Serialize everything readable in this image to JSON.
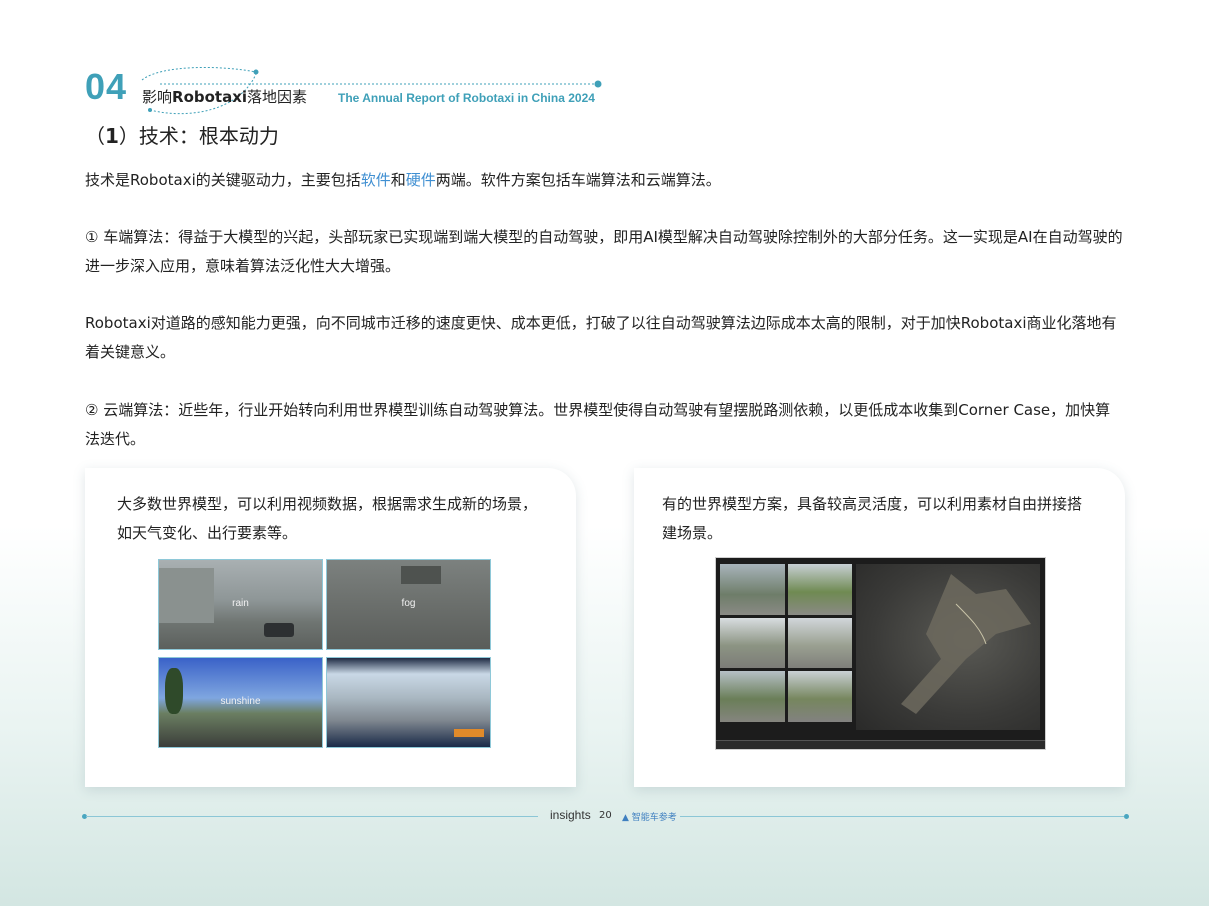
{
  "header": {
    "number": "04",
    "title_prefix": "影响",
    "title_bold": "Robotaxi",
    "title_suffix": "落地因素",
    "title_en": "The Annual Report of Robotaxi in China 2024"
  },
  "section": {
    "title_open": "（",
    "title_num": "1",
    "title_rest": "）技术：根本动力"
  },
  "intro": {
    "pre": "技术是Robotaxi的关键驱动力，主要包括",
    "software": "软件",
    "and": "和",
    "hardware": "硬件",
    "post": "两端。软件方案包括车端算法和云端算法。"
  },
  "para_vehicle": "① 车端算法：得益于大模型的兴起，头部玩家已实现端到端大模型的自动驾驶，即用AI模型解决自动驾驶除控制外的大部分任务。这一实现是AI在自动驾驶的进一步深入应用，意味着算法泛化性大大增强。",
  "para_perception": "Robotaxi对道路的感知能力更强，向不同城市迁移的速度更快、成本更低，打破了以往自动驾驶算法边际成本太高的限制，对于加快Robotaxi商业化落地有着关键意义。",
  "para_cloud": "② 云端算法：近些年，行业开始转向利用世界模型训练自动驾驶算法。世界模型使得自动驾驶有望摆脱路测依赖，以更低成本收集到Corner Case，加快算法迭代。",
  "card_left": {
    "text": "大多数世界模型，可以利用视频数据，根据需求生成新的场景，如天气变化、出行要素等。",
    "labels": {
      "rain": "rain",
      "fog": "fog",
      "sunshine": "sunshine"
    }
  },
  "card_right": {
    "text": "有的世界模型方案，具备较高灵活度，可以利用素材自由拼接搭建场景。"
  },
  "footer": {
    "brand_left": "insights",
    "page": "20",
    "brand_right": "智能车参考"
  },
  "colors": {
    "accent": "#3fa0b8",
    "highlight": "#3f8fd2"
  }
}
